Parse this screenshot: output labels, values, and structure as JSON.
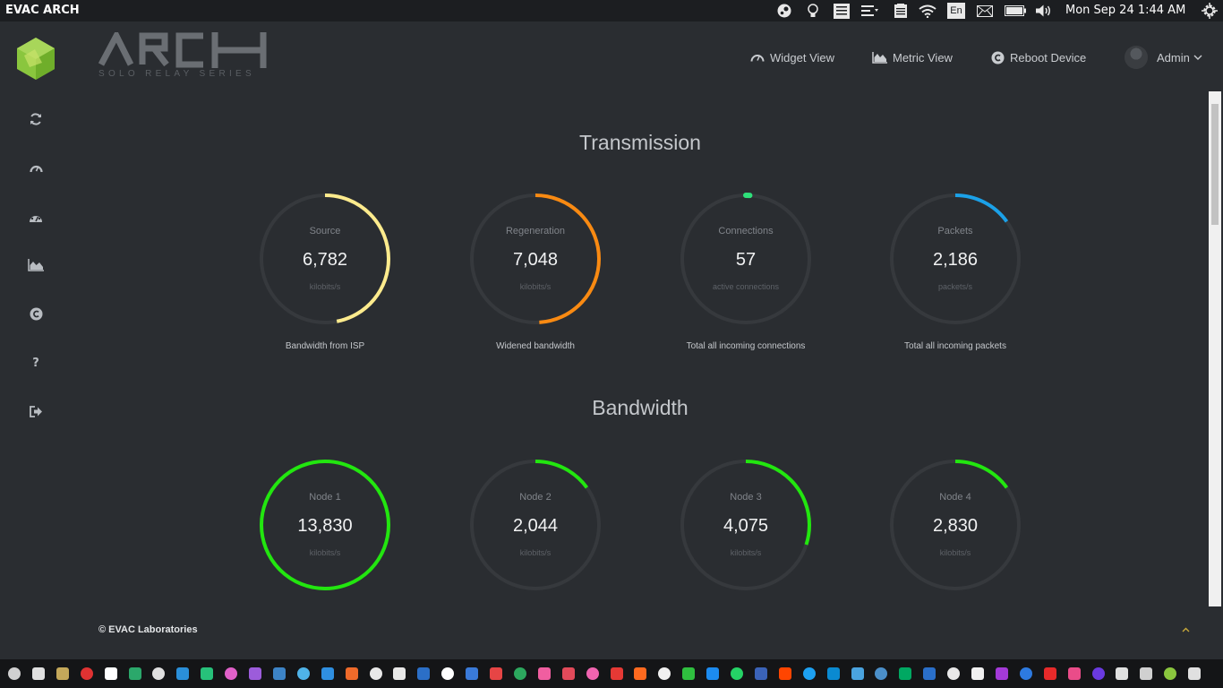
{
  "topbar": {
    "title": "EVAC ARCH",
    "clock": "Mon Sep 24  1:44 AM",
    "tray_icons": [
      "steam-icon",
      "lightbulb-icon",
      "notes-icon",
      "menu-icon",
      "clipboard-icon",
      "wifi-icon",
      "keyboard-layout-icon",
      "mail-icon",
      "battery-icon",
      "volume-icon",
      "settings-gear-icon"
    ],
    "keyboard_layout": "En"
  },
  "sidebar": {
    "icons": [
      "refresh-icon",
      "speedometer-icon",
      "dashboard-icon",
      "area-chart-icon",
      "copyright-icon",
      "help-icon",
      "sign-out-icon"
    ]
  },
  "logo": {
    "name": "ARCH",
    "subtitle": "SOLO RELAY SERIES"
  },
  "nav": {
    "widget_view": "Widget View",
    "metric_view": "Metric View",
    "reboot_device": "Reboot Device",
    "admin": "Admin"
  },
  "sections": {
    "transmission": "Transmission",
    "bandwidth": "Bandwidth"
  },
  "transmission_gauges": [
    {
      "label": "Source",
      "value": "6,782",
      "unit": "kilobits/s",
      "caption": "Bandwidth from ISP",
      "fill": 0.47,
      "color": "#fdeb8d"
    },
    {
      "label": "Regeneration",
      "value": "7,048",
      "unit": "kilobits/s",
      "caption": "Widened bandwidth",
      "fill": 0.49,
      "color": "#f98a12"
    },
    {
      "label": "Connections",
      "value": "57",
      "unit": "active connections",
      "caption": "Total all incoming connections",
      "fill": 0.01,
      "color": "#2ee07a"
    },
    {
      "label": "Packets",
      "value": "2,186",
      "unit": "packets/s",
      "caption": "Total all incoming packets",
      "fill": 0.15,
      "color": "#1ba1e8"
    }
  ],
  "bandwidth_gauges": [
    {
      "label": "Node 1",
      "value": "13,830",
      "unit": "kilobits/s",
      "fill": 1.0,
      "color": "#22e60f"
    },
    {
      "label": "Node 2",
      "value": "2,044",
      "unit": "kilobits/s",
      "fill": 0.15,
      "color": "#22e60f"
    },
    {
      "label": "Node 3",
      "value": "4,075",
      "unit": "kilobits/s",
      "fill": 0.3,
      "color": "#22e60f"
    },
    {
      "label": "Node 4",
      "value": "2,830",
      "unit": "kilobits/s",
      "fill": 0.15,
      "color": "#22e60f"
    }
  ],
  "footer": "© EVAC Laboratories",
  "colors": {
    "background": "#2a2d31",
    "topbar": "#1c1e21",
    "taskbar": "#141517",
    "track": "#36393d",
    "logo_green": "#8ac63e"
  },
  "taskbar": {
    "icons": [
      "app-1-icon",
      "app-2-icon",
      "app-3-icon",
      "opera-icon",
      "app-5-icon",
      "telegram-icon",
      "editor-icon",
      "webstorm-icon",
      "pycharm-icon",
      "jetbrains-icon",
      "phpstorm-icon",
      "app-12-icon",
      "app-13-icon",
      "box-icon",
      "brave-icon",
      "app-16-icon",
      "home-icon",
      "trello-icon",
      "github-icon",
      "app-20-icon",
      "app-21-icon",
      "app-22-icon",
      "app-23-icon",
      "pocket-icon",
      "app-25-icon",
      "youtube-icon",
      "soundcloud-icon",
      "steam-icon",
      "app-29-icon",
      "messenger-icon",
      "whatsapp-icon",
      "facebook-icon",
      "reddit-icon",
      "twitter-icon",
      "linkedin-icon",
      "app-36-icon",
      "app-37-icon",
      "starbucks-icon",
      "app-39-icon",
      "app-40-icon",
      "app-41-icon",
      "dev-icon",
      "hashnode-icon",
      "pinterest-icon",
      "dribbble-icon",
      "app-46-icon",
      "app-47-icon",
      "app-48-icon",
      "arch-icon",
      "app-50-icon"
    ]
  }
}
